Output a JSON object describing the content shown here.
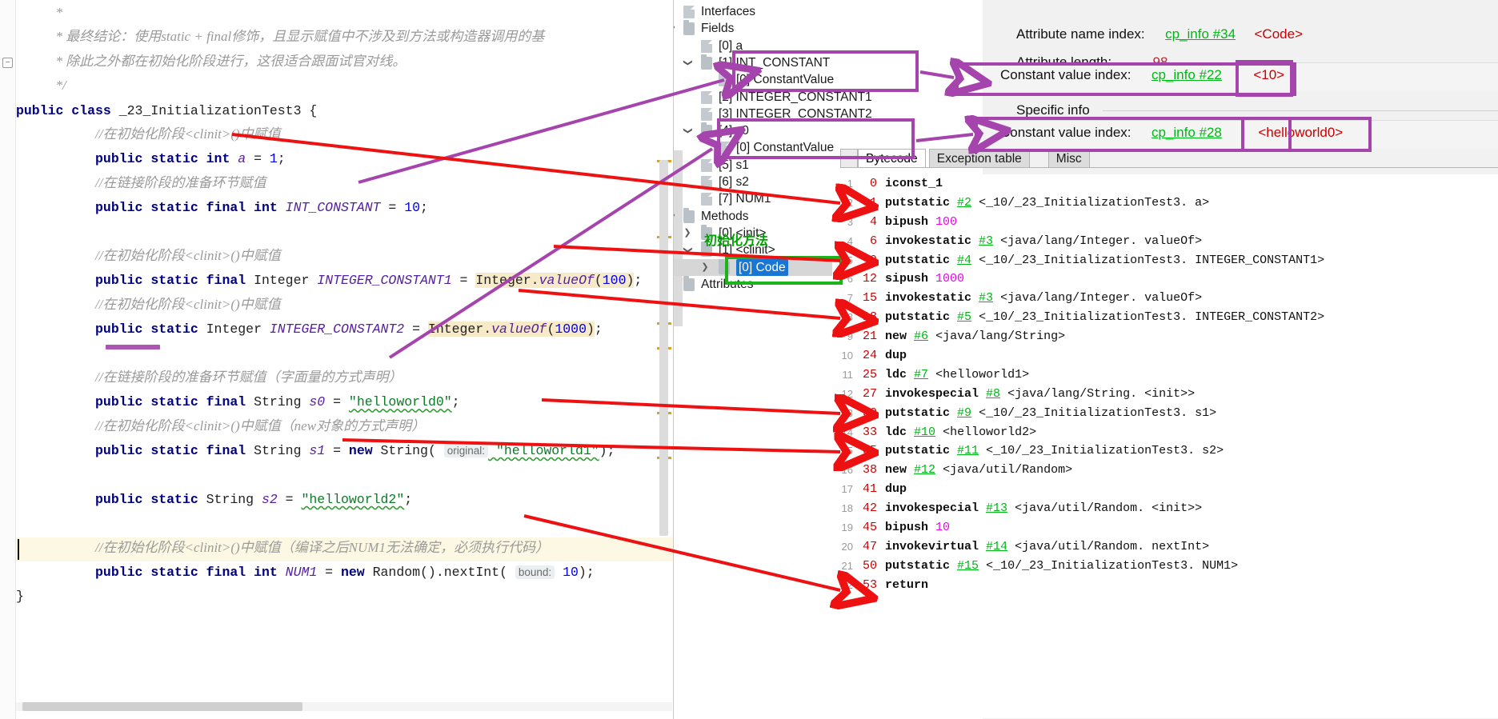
{
  "editor": {
    "lines": [
      {
        "indent": 1,
        "segments": [
          {
            "t": "*",
            "c": "cmt"
          }
        ]
      },
      {
        "indent": 1,
        "segments": [
          {
            "t": "* 最终结论：使用static + final修饰，且显示赋值中不涉及到方法或构造器调用的基",
            "c": "cmt"
          }
        ]
      },
      {
        "indent": 1,
        "segments": [
          {
            "t": "* 除此之外都在初始化阶段进行，这很适合跟面试官对线。",
            "c": "cmt"
          }
        ]
      },
      {
        "indent": 1,
        "segments": [
          {
            "t": "*/",
            "c": "cmt"
          }
        ]
      },
      {
        "indent": 0,
        "segments": [
          {
            "t": "public class ",
            "c": "kw"
          },
          {
            "t": "_23_InitializationTest3 {",
            "c": "cls"
          }
        ]
      },
      {
        "indent": 2,
        "segments": [
          {
            "t": "//在初始化阶段<clinit>()中赋值",
            "c": "cmt"
          }
        ]
      },
      {
        "indent": 2,
        "segments": [
          {
            "t": "public static int ",
            "c": "kw"
          },
          {
            "t": "a",
            "c": "fld"
          },
          {
            "t": " = ",
            "c": "punc"
          },
          {
            "t": "1",
            "c": "num"
          },
          {
            "t": ";",
            "c": "punc"
          }
        ]
      },
      {
        "indent": 2,
        "segments": [
          {
            "t": "//在链接阶段的准备环节赋值",
            "c": "cmt"
          }
        ]
      },
      {
        "indent": 2,
        "segments": [
          {
            "t": "public static final int ",
            "c": "kw"
          },
          {
            "t": "INT_CONSTANT",
            "c": "fld"
          },
          {
            "t": " = ",
            "c": "punc"
          },
          {
            "t": "10",
            "c": "num"
          },
          {
            "t": ";",
            "c": "punc"
          }
        ]
      },
      {
        "indent": 0,
        "segments": []
      },
      {
        "indent": 2,
        "segments": [
          {
            "t": "//在初始化阶段<clinit>()中赋值",
            "c": "cmt"
          }
        ]
      },
      {
        "indent": 2,
        "segments": [
          {
            "t": "public static final ",
            "c": "kw"
          },
          {
            "t": "Integer ",
            "c": "typ"
          },
          {
            "t": "INTEGER_CONSTANT1",
            "c": "fld"
          },
          {
            "t": " = ",
            "c": "punc"
          },
          {
            "t": "Integer.",
            "c": "typ hl"
          },
          {
            "t": "valueOf",
            "c": "fld hl"
          },
          {
            "t": "(",
            "c": "punc hl"
          },
          {
            "t": "100",
            "c": "num hl"
          },
          {
            "t": ")",
            "c": "punc hl"
          },
          {
            "t": ";",
            "c": "punc"
          }
        ]
      },
      {
        "indent": 2,
        "segments": [
          {
            "t": "//在初始化阶段<clinit>()中赋值",
            "c": "cmt"
          }
        ]
      },
      {
        "indent": 2,
        "segments": [
          {
            "t": "public static ",
            "c": "kw"
          },
          {
            "t": "Integer ",
            "c": "typ"
          },
          {
            "t": "INTEGER_CONSTANT2",
            "c": "fld"
          },
          {
            "t": " = ",
            "c": "punc"
          },
          {
            "t": "Integer.",
            "c": "typ hl"
          },
          {
            "t": "valueOf",
            "c": "fld hl"
          },
          {
            "t": "(",
            "c": "punc hl"
          },
          {
            "t": "1000",
            "c": "num hl"
          },
          {
            "t": ")",
            "c": "punc hl"
          },
          {
            "t": ";",
            "c": "punc"
          }
        ]
      },
      {
        "indent": 0,
        "segments": []
      },
      {
        "indent": 2,
        "segments": [
          {
            "t": "//在链接阶段的准备环节赋值（字面量的方式声明）",
            "c": "cmt"
          }
        ]
      },
      {
        "indent": 2,
        "segments": [
          {
            "t": "public static final ",
            "c": "kw"
          },
          {
            "t": "String ",
            "c": "typ"
          },
          {
            "t": "s0",
            "c": "fld"
          },
          {
            "t": " = ",
            "c": "punc"
          },
          {
            "t": "\"helloworld0\"",
            "c": "str"
          },
          {
            "t": ";",
            "c": "punc"
          }
        ]
      },
      {
        "indent": 2,
        "segments": [
          {
            "t": "//在初始化阶段<clinit>()中赋值（new对象的方式声明）",
            "c": "cmt"
          }
        ]
      },
      {
        "indent": 2,
        "segments": [
          {
            "t": "public static final ",
            "c": "kw"
          },
          {
            "t": "String ",
            "c": "typ"
          },
          {
            "t": "s1",
            "c": "fld"
          },
          {
            "t": " = ",
            "c": "punc"
          },
          {
            "t": "new ",
            "c": "kw"
          },
          {
            "t": "String",
            "c": "typ"
          },
          {
            "t": "( ",
            "c": "punc"
          },
          {
            "t": "original:",
            "c": "hint"
          },
          {
            "t": " \"helloworld1\"",
            "c": "str"
          },
          {
            "t": ");",
            "c": "punc"
          }
        ]
      },
      {
        "indent": 0,
        "segments": []
      },
      {
        "indent": 2,
        "segments": [
          {
            "t": "public static ",
            "c": "kw"
          },
          {
            "t": "String ",
            "c": "typ"
          },
          {
            "t": "s2",
            "c": "fld"
          },
          {
            "t": " = ",
            "c": "punc"
          },
          {
            "t": "\"helloworld2\"",
            "c": "str"
          },
          {
            "t": ";",
            "c": "punc"
          }
        ]
      },
      {
        "indent": 0,
        "segments": []
      },
      {
        "indent": 2,
        "segments": [
          {
            "t": "//在初始化阶段<clinit>()中赋值（编译之后NUM1无法确定，必须执行代码）",
            "c": "cmt"
          }
        ]
      },
      {
        "indent": 2,
        "segments": [
          {
            "t": "public static final int ",
            "c": "kw"
          },
          {
            "t": "NUM1",
            "c": "fld"
          },
          {
            "t": " = ",
            "c": "punc"
          },
          {
            "t": "new ",
            "c": "kw"
          },
          {
            "t": "Random",
            "c": "typ"
          },
          {
            "t": "().",
            "c": "punc"
          },
          {
            "t": "nextInt",
            "c": "typ"
          },
          {
            "t": "( ",
            "c": "punc"
          },
          {
            "t": "bound:",
            "c": "hint"
          },
          {
            "t": " ",
            "c": "punc"
          },
          {
            "t": "10",
            "c": "num"
          },
          {
            "t": ");",
            "c": "punc"
          }
        ]
      },
      {
        "indent": 0,
        "segments": [
          {
            "t": "}",
            "c": "punc"
          }
        ]
      }
    ]
  },
  "tree": {
    "nodes": [
      {
        "depth": 1,
        "twist": "",
        "icon": "file",
        "label": "Interfaces",
        "selected": false
      },
      {
        "depth": 1,
        "twist": "v",
        "icon": "folder",
        "label": "Fields",
        "selected": false
      },
      {
        "depth": 2,
        "twist": "",
        "icon": "file",
        "label": "[0] a",
        "selected": false
      },
      {
        "depth": 2,
        "twist": "v",
        "icon": "folder",
        "label": "[1] INT_CONSTANT",
        "selected": false
      },
      {
        "depth": 3,
        "twist": "",
        "icon": "file",
        "label": "[0] ConstantValue",
        "selected": false
      },
      {
        "depth": 2,
        "twist": "",
        "icon": "file",
        "label": "[2] INTEGER_CONSTANT1",
        "selected": false
      },
      {
        "depth": 2,
        "twist": "",
        "icon": "file",
        "label": "[3] INTEGER_CONSTANT2",
        "selected": false
      },
      {
        "depth": 2,
        "twist": "v",
        "icon": "folder",
        "label": "[4] s0",
        "selected": false
      },
      {
        "depth": 3,
        "twist": "",
        "icon": "file",
        "label": "[0] ConstantValue",
        "selected": false
      },
      {
        "depth": 2,
        "twist": "",
        "icon": "file",
        "label": "[5] s1",
        "selected": false
      },
      {
        "depth": 2,
        "twist": "",
        "icon": "file",
        "label": "[6] s2",
        "selected": false
      },
      {
        "depth": 2,
        "twist": "",
        "icon": "file",
        "label": "[7] NUM1",
        "selected": false
      },
      {
        "depth": 1,
        "twist": "v",
        "icon": "folder",
        "label": "Methods",
        "selected": false
      },
      {
        "depth": 2,
        "twist": ">",
        "icon": "folder",
        "label": "[0] <init>",
        "selected": false
      },
      {
        "depth": 2,
        "twist": "v",
        "icon": "folder",
        "label": "[1] <clinit>",
        "selected": false
      },
      {
        "depth": 3,
        "twist": ">",
        "icon": "folder",
        "label": "[0] Code",
        "selected": true
      },
      {
        "depth": 1,
        "twist": ">",
        "icon": "folder",
        "label": "Attributes",
        "selected": false
      }
    ]
  },
  "detail": {
    "attribute_name_index_label": "Attribute name index:",
    "attribute_name_index_value": "cp_info #34",
    "attribute_name_index_desc": "<Code>",
    "attribute_length_label": "Attribute length:",
    "attribute_length_value": "98",
    "constant_value_index_1_label": "Constant value index:",
    "constant_value_index_1_value": "cp_info #22",
    "constant_value_index_1_desc": "<10>",
    "specific_info_label": "Specific info",
    "constant_value_index_2_label": "Constant value index:",
    "constant_value_index_2_value": "cp_info #28",
    "constant_value_index_2_desc": "<helloworld0>",
    "tabs": [
      {
        "label": "Bytecode",
        "active": true
      },
      {
        "label": "Exception table",
        "active": false
      },
      {
        "label": "Misc",
        "active": false
      }
    ]
  },
  "bytecode": {
    "rows": [
      {
        "no": "1",
        "off": "0",
        "mnemonic": "iconst_1",
        "ref": "",
        "desc": "",
        "imm": ""
      },
      {
        "no": "2",
        "off": "1",
        "mnemonic": "putstatic",
        "ref": "#2",
        "desc": "<_10/_23_InitializationTest3. a>",
        "imm": ""
      },
      {
        "no": "3",
        "off": "4",
        "mnemonic": "bipush",
        "ref": "",
        "desc": "",
        "imm": "100"
      },
      {
        "no": "4",
        "off": "6",
        "mnemonic": "invokestatic",
        "ref": "#3",
        "desc": "<java/lang/Integer. valueOf>",
        "imm": ""
      },
      {
        "no": "5",
        "off": "9",
        "mnemonic": "putstatic",
        "ref": "#4",
        "desc": "<_10/_23_InitializationTest3. INTEGER_CONSTANT1>",
        "imm": ""
      },
      {
        "no": "6",
        "off": "12",
        "mnemonic": "sipush",
        "ref": "",
        "desc": "",
        "imm": "1000"
      },
      {
        "no": "7",
        "off": "15",
        "mnemonic": "invokestatic",
        "ref": "#3",
        "desc": "<java/lang/Integer. valueOf>",
        "imm": ""
      },
      {
        "no": "8",
        "off": "18",
        "mnemonic": "putstatic",
        "ref": "#5",
        "desc": "<_10/_23_InitializationTest3. INTEGER_CONSTANT2>",
        "imm": ""
      },
      {
        "no": "9",
        "off": "21",
        "mnemonic": "new",
        "ref": "#6",
        "desc": "<java/lang/String>",
        "imm": ""
      },
      {
        "no": "10",
        "off": "24",
        "mnemonic": "dup",
        "ref": "",
        "desc": "",
        "imm": ""
      },
      {
        "no": "11",
        "off": "25",
        "mnemonic": "ldc",
        "ref": "#7",
        "desc": "<helloworld1>",
        "imm": ""
      },
      {
        "no": "12",
        "off": "27",
        "mnemonic": "invokespecial",
        "ref": "#8",
        "desc": "<java/lang/String. <init>>",
        "imm": ""
      },
      {
        "no": "13",
        "off": "30",
        "mnemonic": "putstatic",
        "ref": "#9",
        "desc": "<_10/_23_InitializationTest3. s1>",
        "imm": ""
      },
      {
        "no": "14",
        "off": "33",
        "mnemonic": "ldc",
        "ref": "#10",
        "desc": "<helloworld2>",
        "imm": ""
      },
      {
        "no": "15",
        "off": "35",
        "mnemonic": "putstatic",
        "ref": "#11",
        "desc": "<_10/_23_InitializationTest3. s2>",
        "imm": ""
      },
      {
        "no": "16",
        "off": "38",
        "mnemonic": "new",
        "ref": "#12",
        "desc": "<java/util/Random>",
        "imm": ""
      },
      {
        "no": "17",
        "off": "41",
        "mnemonic": "dup",
        "ref": "",
        "desc": "",
        "imm": ""
      },
      {
        "no": "18",
        "off": "42",
        "mnemonic": "invokespecial",
        "ref": "#13",
        "desc": "<java/util/Random. <init>>",
        "imm": ""
      },
      {
        "no": "19",
        "off": "45",
        "mnemonic": "bipush",
        "ref": "",
        "desc": "",
        "imm": "10"
      },
      {
        "no": "20",
        "off": "47",
        "mnemonic": "invokevirtual",
        "ref": "#14",
        "desc": "<java/util/Random. nextInt>",
        "imm": ""
      },
      {
        "no": "21",
        "off": "50",
        "mnemonic": "putstatic",
        "ref": "#15",
        "desc": "<_10/_23_InitializationTest3. NUM1>",
        "imm": ""
      },
      {
        "no": "22",
        "off": "53",
        "mnemonic": "return",
        "ref": "",
        "desc": "",
        "imm": ""
      }
    ]
  },
  "annotations": {
    "init_method_label": "初始化方法",
    "colors": {
      "purple": "#a544ac",
      "red": "#ee1111",
      "green": "#00a000"
    }
  }
}
